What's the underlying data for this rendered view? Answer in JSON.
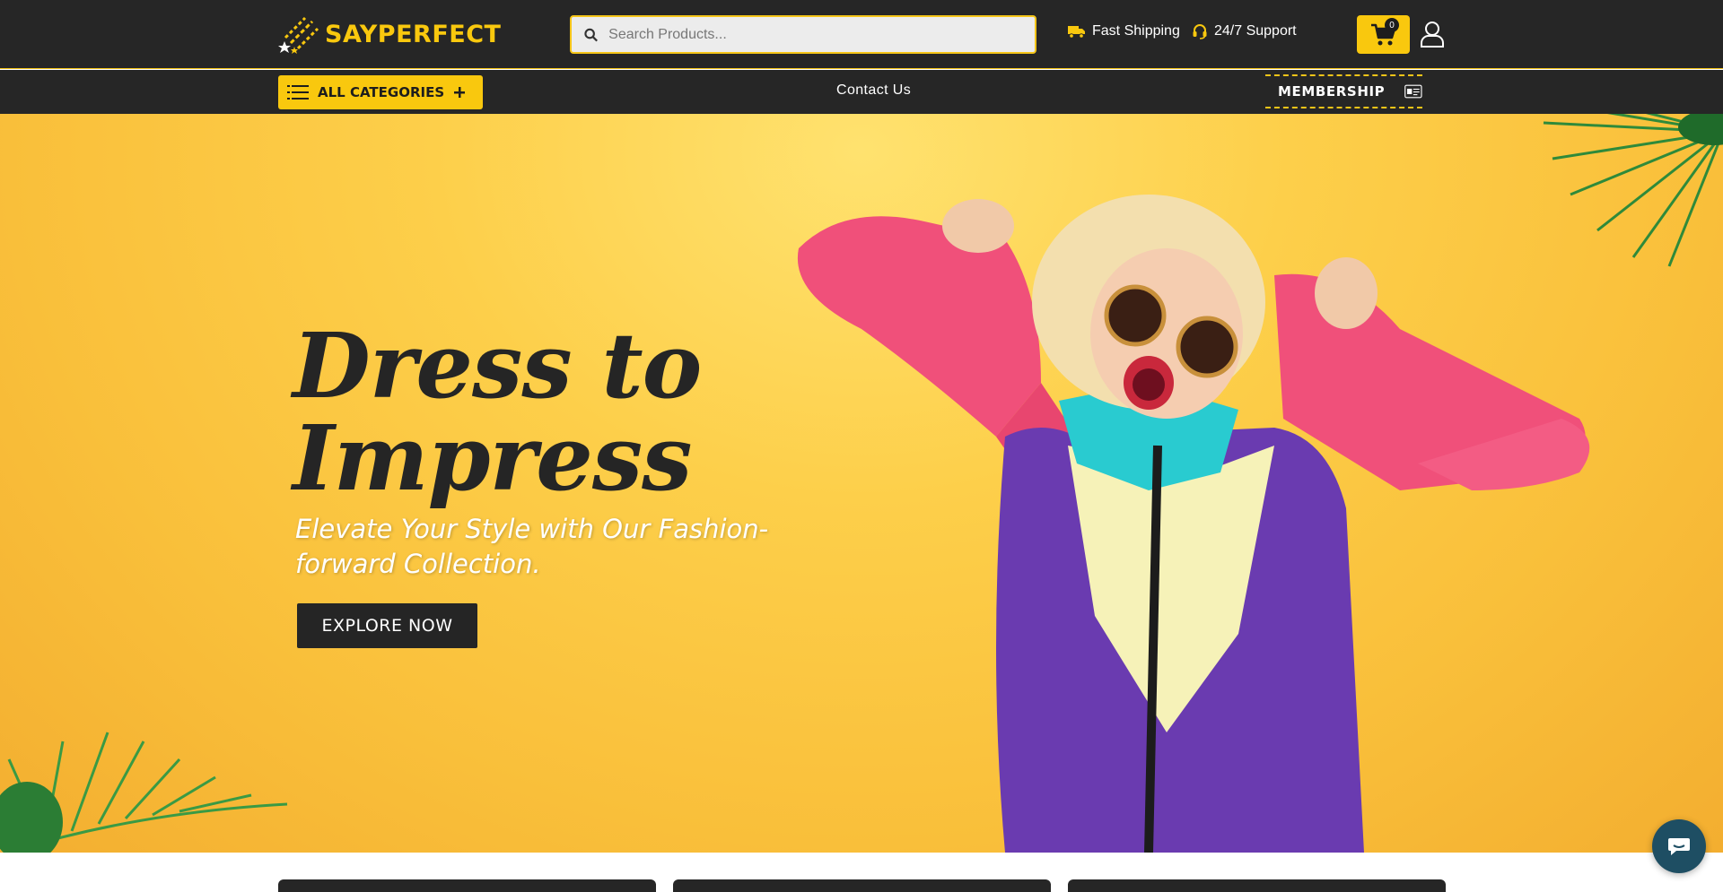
{
  "brand": {
    "name": "SAYPERFECT",
    "accent": "#f9c80e",
    "dark": "#262626"
  },
  "header": {
    "search_placeholder": "Search Products...",
    "features": [
      {
        "icon": "truck-icon",
        "label": "Fast Shipping"
      },
      {
        "icon": "headset-icon",
        "label": "24/7 Support"
      }
    ],
    "cart_count": "0"
  },
  "nav": {
    "all_categories": "ALL CATEGORIES",
    "contact": "Contact Us",
    "membership": "MEMBERSHIP"
  },
  "hero": {
    "title_line1": "Dress to",
    "title_line2": "Impress",
    "subtitle": "Elevate Your Style with Our Fashion-forward Collection.",
    "cta": "EXPLORE NOW"
  }
}
